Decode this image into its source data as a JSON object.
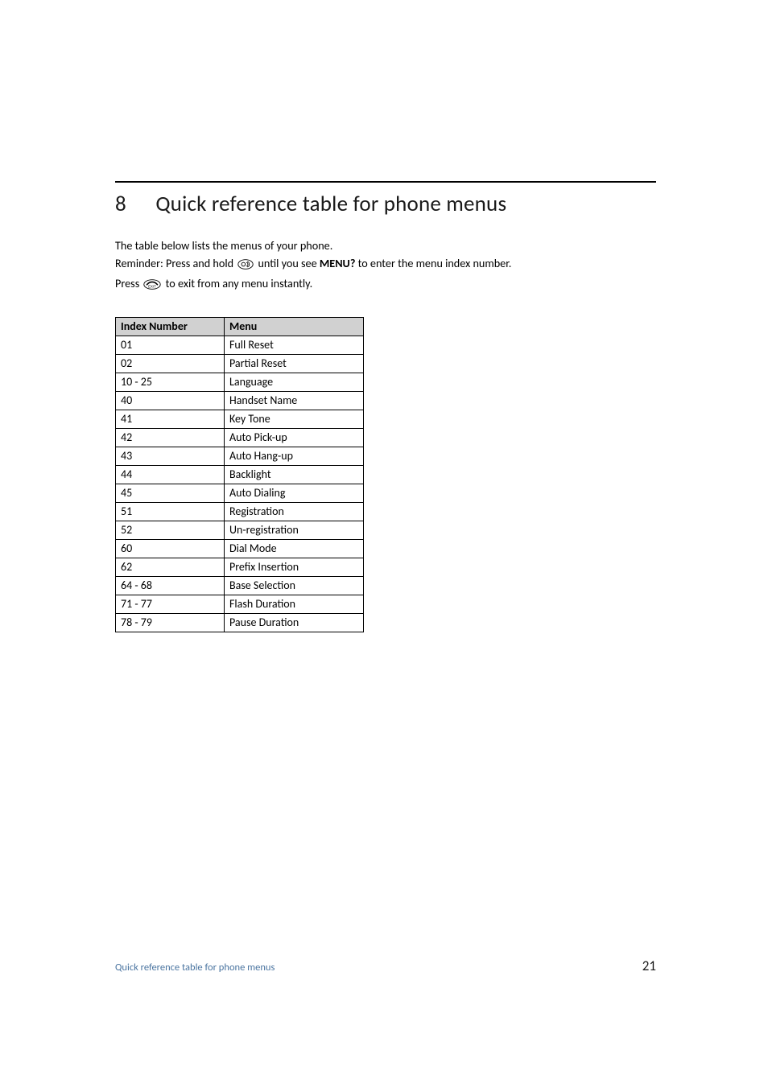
{
  "heading": {
    "number": "8",
    "title": "Quick reference table for phone menus"
  },
  "intro": {
    "line1": "The table below lists the menus of your phone.",
    "line2_pre": "Reminder: Press and hold ",
    "line2_mid": " until you see ",
    "line2_bold": "MENU?",
    "line2_post": " to enter the menu index number.",
    "line3_pre": "Press ",
    "line3_post": " to exit from any menu instantly."
  },
  "icons": {
    "hold": "redial-hold-key-icon",
    "exit": "exit-key-icon"
  },
  "table": {
    "headers": {
      "col1": "Index Number",
      "col2": "Menu"
    },
    "rows": [
      {
        "index": "01",
        "menu": "Full Reset"
      },
      {
        "index": "02",
        "menu": "Partial Reset"
      },
      {
        "index": "10 - 25",
        "menu": "Language"
      },
      {
        "index": "40",
        "menu": "Handset Name"
      },
      {
        "index": "41",
        "menu": "Key Tone"
      },
      {
        "index": "42",
        "menu": "Auto Pick-up"
      },
      {
        "index": "43",
        "menu": "Auto Hang-up"
      },
      {
        "index": "44",
        "menu": "Backlight"
      },
      {
        "index": "45",
        "menu": "Auto Dialing"
      },
      {
        "index": "51",
        "menu": "Registration"
      },
      {
        "index": "52",
        "menu": "Un-registration"
      },
      {
        "index": "60",
        "menu": "Dial Mode"
      },
      {
        "index": "62",
        "menu": "Prefix Insertion"
      },
      {
        "index": "64 - 68",
        "menu": "Base Selection"
      },
      {
        "index": "71 - 77",
        "menu": "Flash Duration"
      },
      {
        "index": "78 - 79",
        "menu": "Pause Duration"
      }
    ]
  },
  "footer": {
    "section": "Quick reference table for phone menus",
    "page": "21"
  }
}
